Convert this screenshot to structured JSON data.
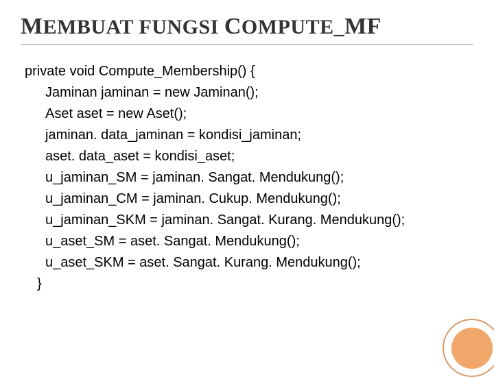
{
  "title_html": "<span class='caps'>M</span>EMBUAT FUNGSI <span class='caps'>C</span>OMPUTE_<span class='caps'>MF</span>",
  "code": {
    "line0": "private void Compute_Membership() {",
    "line1": "Jaminan jaminan = new Jaminan();",
    "line2": "Aset aset = new Aset();",
    "line3": "jaminan. data_jaminan = kondisi_jaminan;",
    "line4": "aset. data_aset = kondisi_aset;",
    "line5": "u_jaminan_SM = jaminan. Sangat. Mendukung();",
    "line6": "u_jaminan_CM = jaminan. Cukup. Mendukung();",
    "line7": "u_jaminan_SKM = jaminan. Sangat. Kurang. Mendukung();",
    "line8": "u_aset_SM = aset. Sangat. Mendukung();",
    "line9": "u_aset_SKM = aset. Sangat. Kurang. Mendukung();",
    "line10": "}"
  }
}
